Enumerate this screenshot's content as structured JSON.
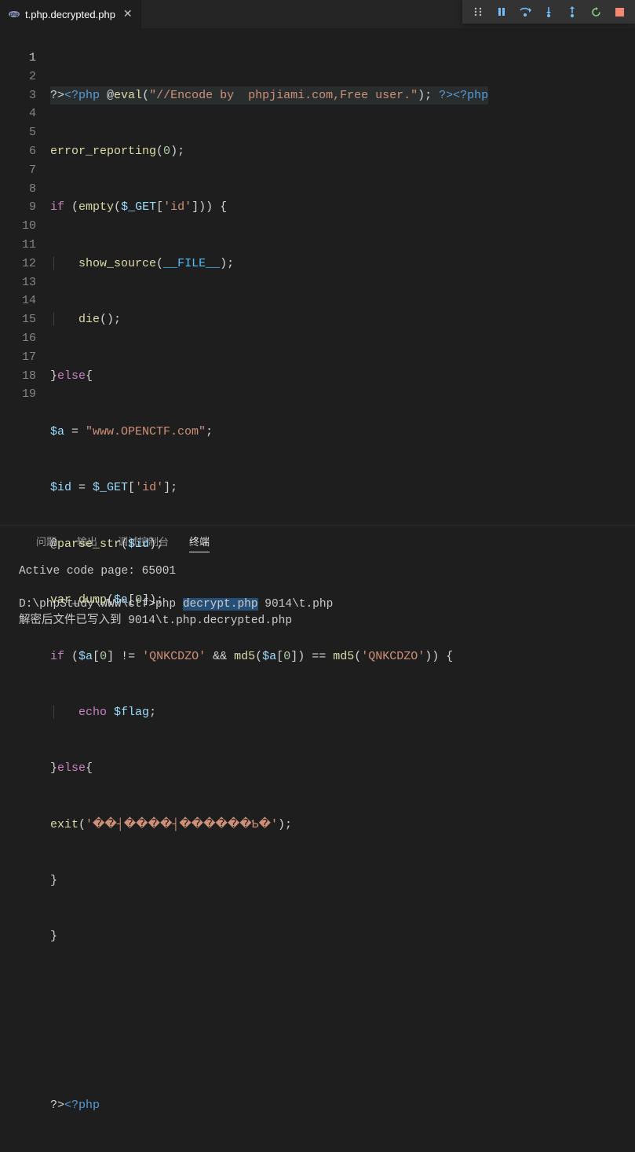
{
  "tab": {
    "filename": "t.php.decrypted.php",
    "close": "✕"
  },
  "debug_toolbar": {
    "grip": "grip",
    "pause": "pause",
    "step_over": "step-over",
    "step_into": "step-into",
    "step_out": "step-out",
    "restart": "restart",
    "stop": "stop"
  },
  "gutter": [
    "1",
    "2",
    "3",
    "4",
    "5",
    "6",
    "7",
    "8",
    "9",
    "10",
    "11",
    "12",
    "13",
    "14",
    "15",
    "16",
    "17",
    "18",
    "19"
  ],
  "code": {
    "l1": {
      "a": "?>",
      "b": "<?php",
      "c": " @",
      "d": "eval",
      "e": "(",
      "f": "\"//Encode by  phpjiami.com,Free user.\"",
      "g": "); ",
      "h": "?>",
      "i": "<?php"
    },
    "l2": {
      "a": "error_reporting",
      "b": "(",
      "c": "0",
      "d": ");"
    },
    "l3": {
      "a": "if",
      "b": " (",
      "c": "empty",
      "d": "(",
      "e": "$_GET",
      "f": "[",
      "g": "'id'",
      "h": "])) {"
    },
    "l4": {
      "indent": "│   ",
      "a": "show_source",
      "b": "(",
      "c": "__FILE__",
      "d": ");"
    },
    "l5": {
      "indent": "│   ",
      "a": "die",
      "b": "();"
    },
    "l6": {
      "a": "}",
      "b": "else",
      "c": "{"
    },
    "l7": {
      "a": "$a",
      "b": " = ",
      "c": "\"www.OPENCTF.com\"",
      "d": ";"
    },
    "l8": {
      "a": "$id",
      "b": " = ",
      "c": "$_GET",
      "d": "[",
      "e": "'id'",
      "f": "];"
    },
    "l9": {
      "a": "@",
      "b": "parse_str",
      "c": "(",
      "d": "$id",
      "e": ");"
    },
    "l10": {
      "a": "var_dump",
      "b": "(",
      "c": "$a",
      "d": "[",
      "e": "0",
      "f": "]);"
    },
    "l11": {
      "a": "if",
      "b": " (",
      "c": "$a",
      "d": "[",
      "e": "0",
      "f": "] != ",
      "g": "'QNKCDZO'",
      "h": " && ",
      "i": "md5",
      "j": "(",
      "k": "$a",
      "l": "[",
      "m": "0",
      "n": "]) == ",
      "o": "md5",
      "p": "(",
      "q": "'QNKCDZO'",
      "r": ")) {"
    },
    "l12": {
      "indent": "│   ",
      "a": "echo",
      "b": " ",
      "c": "$flag",
      "d": ";"
    },
    "l13": {
      "a": "}",
      "b": "else",
      "c": "{"
    },
    "l14": {
      "a": "exit",
      "b": "(",
      "c": "'��┤����┤������Ƅ�'",
      "d": ");"
    },
    "l15": {
      "a": "}"
    },
    "l16": {
      "a": "}"
    },
    "l17": {
      "a": ""
    },
    "l18": {
      "a": ""
    },
    "l19": {
      "a": "?>",
      "b": "<?php"
    }
  },
  "panel": {
    "tabs": {
      "problems": "问题",
      "output": "输出",
      "debug_console": "调试控制台",
      "terminal": "终端"
    },
    "active": "terminal"
  },
  "terminal": {
    "line1": "Active code page: 65001",
    "line2_a": "D:\\phpStudy\\WWW\\ctf>php ",
    "line2_sel": "decrypt.php",
    "line2_b": " 9014\\t.php",
    "line3": "解密后文件已写入到 9014\\t.php.decrypted.php"
  }
}
